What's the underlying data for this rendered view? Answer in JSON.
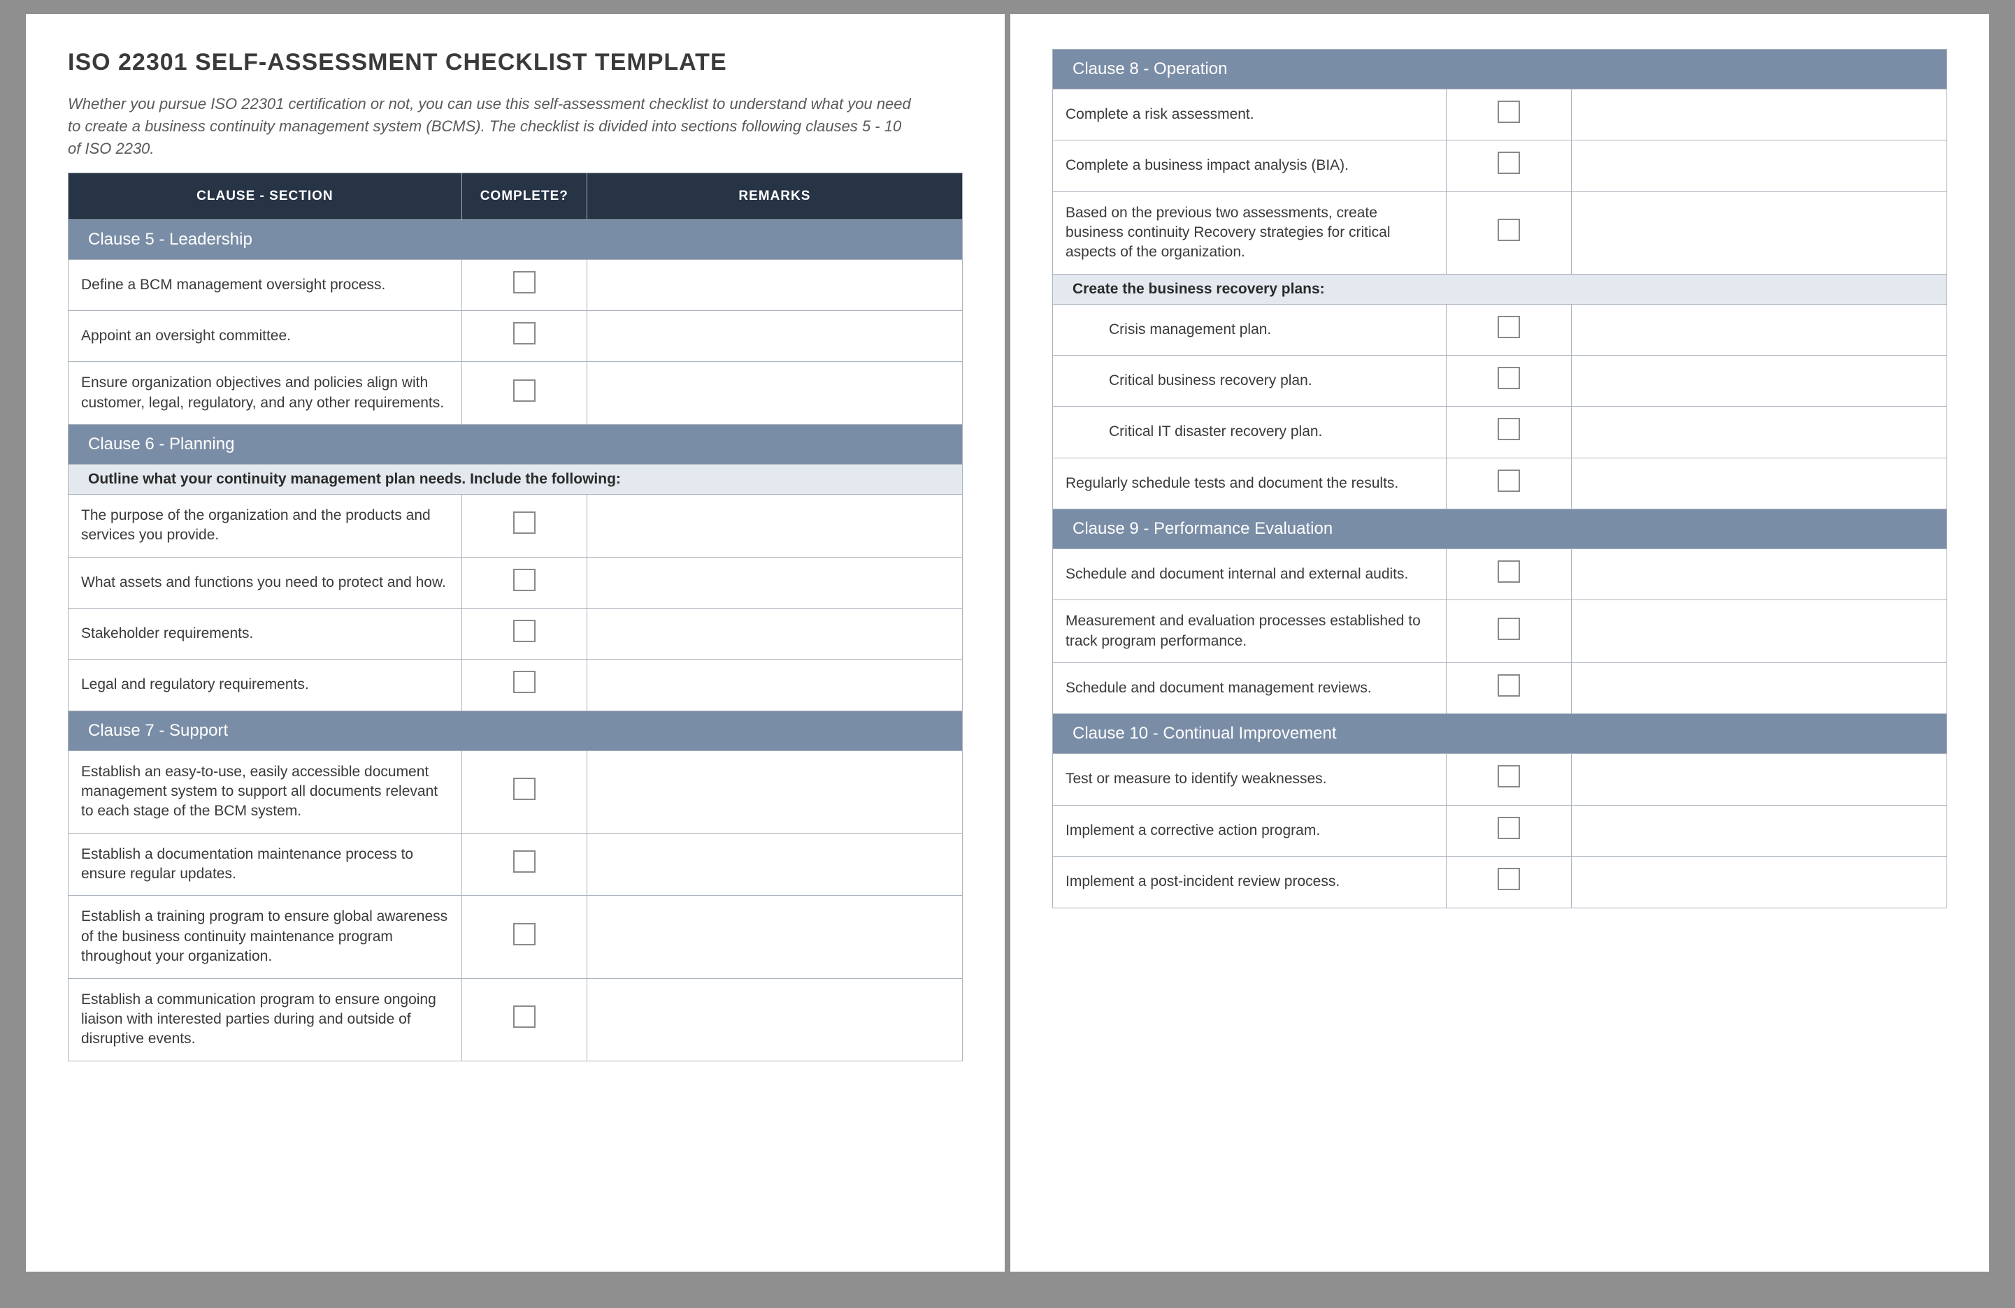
{
  "title": "ISO 22301 SELF-ASSESSMENT CHECKLIST TEMPLATE",
  "intro": "Whether you pursue ISO 22301 certification or not, you can use this self-assessment checklist to understand what you need to create a business continuity management system (BCMS). The checklist is divided into sections following clauses 5 - 10 of ISO 2230.",
  "headers": {
    "clause": "CLAUSE - SECTION",
    "complete": "COMPLETE?",
    "remarks": "REMARKS"
  },
  "clause5": {
    "title": "Clause 5 - Leadership",
    "items": [
      "Define a BCM management oversight process.",
      "Appoint an oversight committee.",
      "Ensure organization objectives and policies align with customer, legal, regulatory, and any other requirements."
    ]
  },
  "clause6": {
    "title": "Clause 6 - Planning",
    "sub": "Outline what your continuity management plan needs. Include the following:",
    "items": [
      "The purpose of the organization and the products and services you provide.",
      "What assets and functions you need to protect and how.",
      "Stakeholder requirements.",
      "Legal and regulatory requirements."
    ]
  },
  "clause7": {
    "title": "Clause 7 - Support",
    "items": [
      "Establish an easy-to-use, easily accessible document management system to support all documents relevant to each stage of the BCM system.",
      "Establish a documentation maintenance process to ensure regular updates.",
      "Establish a training program to ensure global awareness of the business continuity maintenance program throughout your organization.",
      "Establish a communication program to ensure ongoing liaison with interested parties during and outside of disruptive events."
    ]
  },
  "clause8": {
    "title": "Clause 8 - Operation",
    "items_a": [
      "Complete a risk assessment.",
      "Complete a business impact analysis (BIA).",
      "Based on the previous two assessments, create business continuity Recovery strategies for critical aspects of the organization."
    ],
    "sub": "Create the business recovery plans:",
    "items_b": [
      "Crisis management plan.",
      "Critical business recovery plan.",
      "Critical IT disaster recovery plan."
    ],
    "items_c": [
      "Regularly schedule tests and document the results."
    ]
  },
  "clause9": {
    "title": "Clause 9 - Performance Evaluation",
    "items": [
      "Schedule and document internal and external audits.",
      "Measurement and evaluation processes established to track program performance.",
      "Schedule and document management reviews."
    ]
  },
  "clause10": {
    "title": "Clause 10 - Continual Improvement",
    "items": [
      "Test or measure to identify weaknesses.",
      "Implement a corrective action program.",
      "Implement a post-incident review process."
    ]
  }
}
